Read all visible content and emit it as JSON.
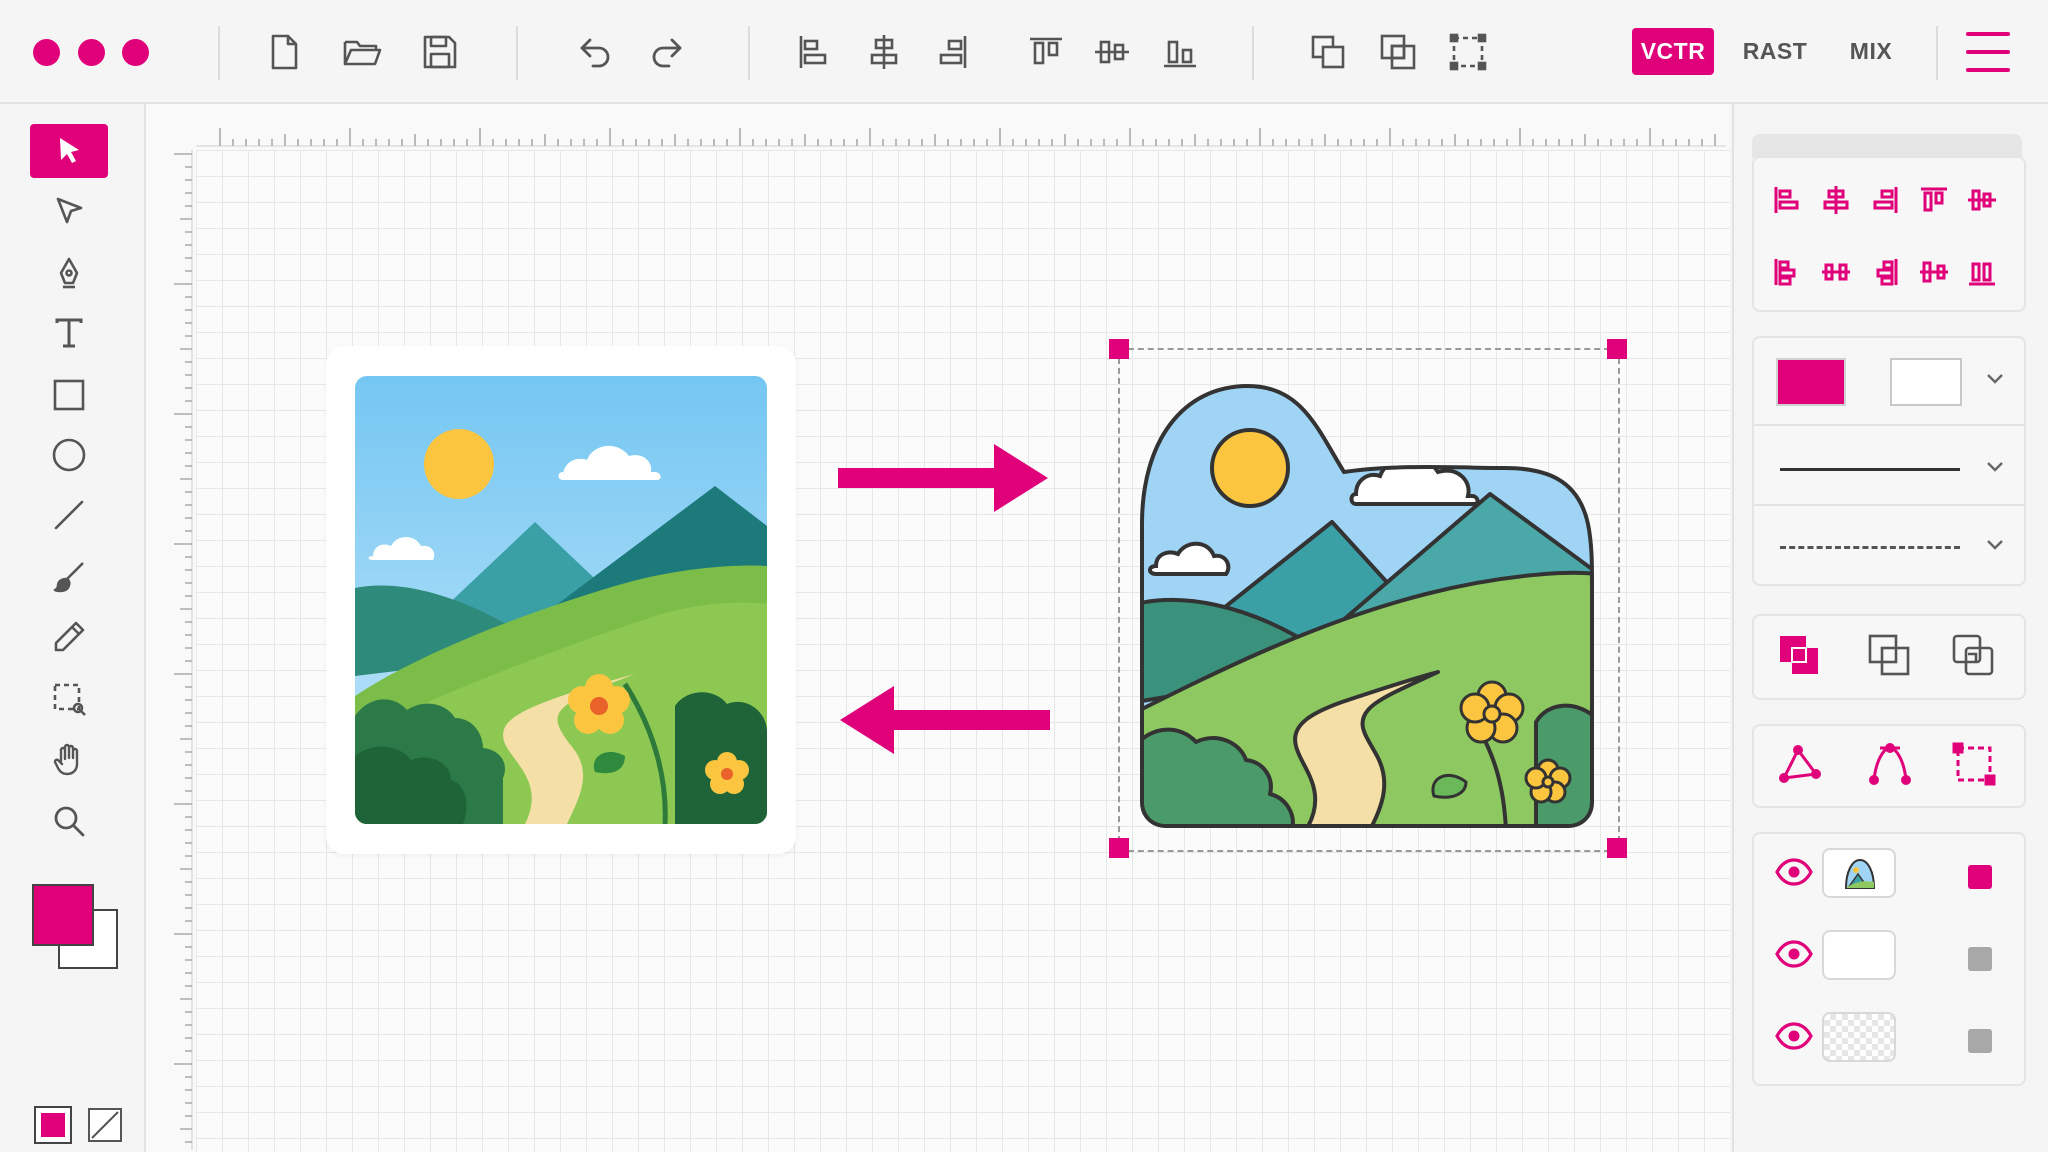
{
  "window": {
    "traffic_lights": [
      "close",
      "minimize",
      "maximize"
    ],
    "accent_color": "#e0007a"
  },
  "toolbar": {
    "file_tools": [
      "new-file-icon",
      "open-folder-icon",
      "save-icon"
    ],
    "history_tools": [
      "undo-icon",
      "redo-icon"
    ],
    "align_tools": [
      "align-left-icon",
      "align-center-h-icon",
      "align-right-icon",
      "align-top-icon",
      "align-middle-v-icon",
      "align-bottom-icon"
    ],
    "arrange_tools": [
      "bring-front-icon",
      "group-icon",
      "crop-frame-icon"
    ],
    "modes": [
      {
        "label": "VCTR",
        "active": true
      },
      {
        "label": "RAST",
        "active": false
      },
      {
        "label": "MIX",
        "active": false
      }
    ],
    "menu_icon": "hamburger-menu-icon"
  },
  "tools": {
    "items": [
      "select-arrow-icon",
      "direct-select-icon",
      "pen-tool-icon",
      "text-tool-icon",
      "rectangle-tool-icon",
      "ellipse-tool-icon",
      "line-tool-icon",
      "brush-tool-icon",
      "pencil-tool-icon",
      "marquee-select-icon",
      "hand-pan-icon",
      "zoom-icon"
    ],
    "active_index": 0,
    "fill_color": "#e0007a",
    "stroke_color": "#ffffff"
  },
  "canvas": {
    "raster_image": "raster-landscape-image",
    "vector_image": "vector-landscape-image",
    "convert_arrow_right": "arrow-right-icon",
    "convert_arrow_left": "arrow-left-icon",
    "selection_color": "#e0007a"
  },
  "panel": {
    "align_row1": [
      "align-left-icon",
      "align-center-h-icon",
      "align-right-icon",
      "align-top-icon",
      "align-middle-v-icon"
    ],
    "align_row2": [
      "distribute-left-icon",
      "distribute-center-h-icon",
      "distribute-right-icon",
      "distribute-middle-v-icon",
      "distribute-bottom-icon"
    ],
    "fill_swatch": "#e0007a",
    "stroke_swatch": "#ffffff",
    "stroke_styles": [
      "solid",
      "dashed"
    ],
    "boolean_ops": [
      "union-icon",
      "intersect-icon",
      "exclude-icon"
    ],
    "path_ops": [
      "anchor-point-icon",
      "curve-icon",
      "transform-box-icon"
    ],
    "layers": [
      {
        "thumb": "landscape",
        "visible": true,
        "lock_color": "#e0007a"
      },
      {
        "thumb": "blank",
        "visible": true,
        "lock_color": "#a8a8a8"
      },
      {
        "thumb": "transparent",
        "visible": true,
        "lock_color": "#a8a8a8"
      }
    ]
  }
}
